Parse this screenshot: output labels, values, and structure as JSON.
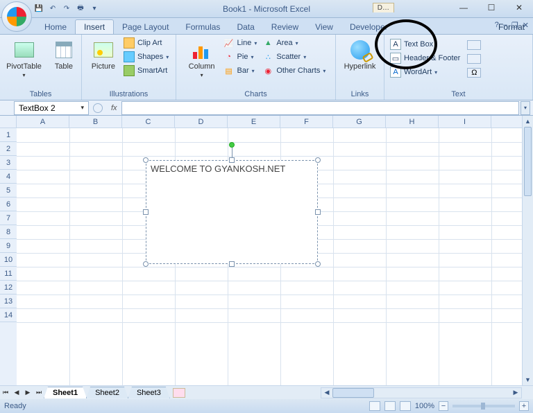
{
  "title": "Book1 - Microsoft Excel",
  "extra_tab": "D…",
  "win": {
    "min": "—",
    "max": "☐",
    "close": "✕"
  },
  "tabs": {
    "home": "Home",
    "insert": "Insert",
    "page_layout": "Page Layout",
    "formulas": "Formulas",
    "data": "Data",
    "review": "Review",
    "view": "View",
    "developer": "Developer",
    "format": "Format"
  },
  "help": {
    "q": "?",
    "min": "–",
    "rest": "❐",
    "close": "✕"
  },
  "ribbon": {
    "tables": {
      "pivot": "PivotTable",
      "table": "Table",
      "label": "Tables"
    },
    "illus": {
      "picture": "Picture",
      "clipart": "Clip Art",
      "shapes": "Shapes",
      "smartart": "SmartArt",
      "label": "Illustrations"
    },
    "charts": {
      "column": "Column",
      "line": "Line",
      "pie": "Pie",
      "bar": "Bar",
      "area": "Area",
      "scatter": "Scatter",
      "other": "Other Charts",
      "label": "Charts"
    },
    "links": {
      "hyperlink": "Hyperlink",
      "label": "Links"
    },
    "text": {
      "textbox": "Text Box",
      "headerfooter": "Header & Footer",
      "wordart": "WordArt",
      "label": "Text"
    }
  },
  "namebox": "TextBox 2",
  "fx": "fx",
  "columns": [
    "A",
    "B",
    "C",
    "D",
    "E",
    "F",
    "G",
    "H",
    "I"
  ],
  "rows": [
    "1",
    "2",
    "3",
    "4",
    "5",
    "6",
    "7",
    "8",
    "9",
    "10",
    "11",
    "12",
    "13",
    "14"
  ],
  "textbox_content": "WELCOME TO GYANKOSH.NET",
  "sheets": {
    "s1": "Sheet1",
    "s2": "Sheet2",
    "s3": "Sheet3"
  },
  "status": {
    "ready": "Ready",
    "zoom": "100%",
    "minus": "−",
    "plus": "+"
  }
}
